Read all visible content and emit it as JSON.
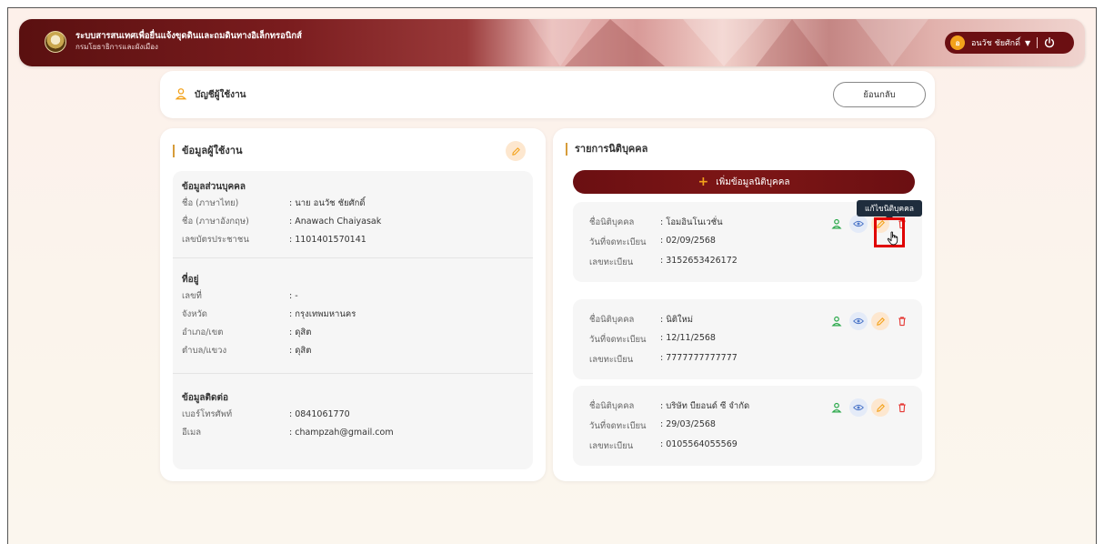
{
  "header": {
    "system_title": "ระบบสารสนเทศเพื่อยื่นแจ้งขุดดินและถมดินทางอิเล็กทรอนิกส์",
    "department": "กรมโยธาธิการและผังเมือง",
    "user": {
      "initial": "อ",
      "name": "อนวัช ชัยศักดิ์"
    }
  },
  "topbar": {
    "title": "บัญชีผู้ใช้งาน",
    "back_label": "ย้อนกลับ"
  },
  "user_info": {
    "title": "ข้อมูลผู้ใช้งาน",
    "personal": {
      "title": "ข้อมูลส่วนบุคคล",
      "rows": [
        {
          "label": "ชื่อ (ภาษาไทย)",
          "value": ": นาย อนวัช ชัยศักดิ์"
        },
        {
          "label": "ชื่อ (ภาษาอังกฤษ)",
          "value": ": Anawach Chaiyasak"
        },
        {
          "label": "เลขบัตรประชาชน",
          "value": ": 1101401570141"
        }
      ]
    },
    "address": {
      "title": "ที่อยู่",
      "rows": [
        {
          "label": "เลขที่",
          "value": ": -"
        },
        {
          "label": "จังหวัด",
          "value": ": กรุงเทพมหานคร"
        },
        {
          "label": "อำเภอ/เขต",
          "value": ": ดุสิต"
        },
        {
          "label": "ตำบล/แขวง",
          "value": ": ดุสิต"
        }
      ]
    },
    "contact": {
      "title": "ข้อมูลติดต่อ",
      "rows": [
        {
          "label": "เบอร์โทรศัพท์",
          "value": ": 0841061770"
        },
        {
          "label": "อีเมล",
          "value": ": champzah@gmail.com"
        }
      ]
    }
  },
  "entities": {
    "title": "รายการนิติบุคคล",
    "add_label": "เพิ่มข้อมูลนิติบุคคล",
    "labels": {
      "name": "ชื่อนิติบุคคล",
      "reg_date": "วันที่จดทะเบียน",
      "reg_no": "เลขทะเบียน"
    },
    "items": [
      {
        "name": ": โอมอินโนเวชั่น",
        "reg_date": ": 02/09/2568",
        "reg_no": ": 3152653426172"
      },
      {
        "name": ": นิติใหม่",
        "reg_date": ": 12/11/2568",
        "reg_no": ": 7777777777777"
      },
      {
        "name": ": บริษัท บียอนด์ ซี จำกัด",
        "reg_date": ": 29/03/2568",
        "reg_no": ": 0105564055569"
      }
    ],
    "tooltip": "แก้ไขนิติบุคคล"
  },
  "colors": {
    "primary": "#6b0f12",
    "accent": "#f3a21b",
    "highlight": "#e00000"
  }
}
